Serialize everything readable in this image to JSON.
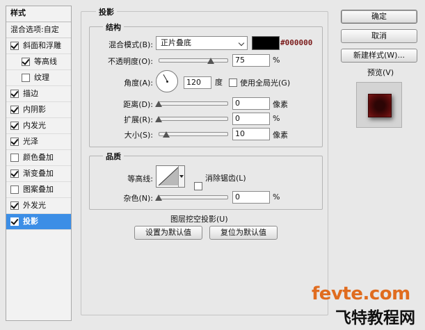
{
  "style_list": {
    "header": "样式",
    "blend_options": "混合选项:自定",
    "items": [
      {
        "label": "斜面和浮雕",
        "checked": true,
        "indent": false,
        "selected": false
      },
      {
        "label": "等高线",
        "checked": true,
        "indent": true,
        "selected": false
      },
      {
        "label": "纹理",
        "checked": false,
        "indent": true,
        "selected": false
      },
      {
        "label": "描边",
        "checked": true,
        "indent": false,
        "selected": false
      },
      {
        "label": "内阴影",
        "checked": true,
        "indent": false,
        "selected": false
      },
      {
        "label": "内发光",
        "checked": true,
        "indent": false,
        "selected": false
      },
      {
        "label": "光泽",
        "checked": true,
        "indent": false,
        "selected": false
      },
      {
        "label": "颜色叠加",
        "checked": false,
        "indent": false,
        "selected": false
      },
      {
        "label": "渐变叠加",
        "checked": true,
        "indent": false,
        "selected": false
      },
      {
        "label": "图案叠加",
        "checked": false,
        "indent": false,
        "selected": false
      },
      {
        "label": "外发光",
        "checked": true,
        "indent": false,
        "selected": false
      },
      {
        "label": "投影",
        "checked": true,
        "indent": false,
        "selected": true
      }
    ]
  },
  "panel": {
    "title": "投影",
    "structure": {
      "title": "结构",
      "blend_mode_label": "混合模式(B):",
      "blend_mode_value": "正片叠底",
      "color_hex": "#000000",
      "opacity_label": "不透明度(O):",
      "opacity_value": "75",
      "opacity_unit": "%",
      "angle_label": "角度(A):",
      "angle_value": "120",
      "angle_unit": "度",
      "global_light_label": "使用全局光(G)",
      "distance_label": "距离(D):",
      "distance_value": "0",
      "distance_unit": "像素",
      "spread_label": "扩展(R):",
      "spread_value": "0",
      "spread_unit": "%",
      "size_label": "大小(S):",
      "size_value": "10",
      "size_unit": "像素"
    },
    "quality": {
      "title": "品质",
      "contour_label": "等高线:",
      "antialias_label": "消除锯齿(L)",
      "noise_label": "杂色(N):",
      "noise_value": "0",
      "noise_unit": "%"
    },
    "knockout_label": "图层挖空投影(U)",
    "make_default": "设置为默认值",
    "reset_default": "复位为默认值"
  },
  "buttons": {
    "ok": "确定",
    "cancel": "取消",
    "new_style": "新建样式(W)...",
    "preview_label": "预览(V)"
  },
  "watermark": {
    "line1": "fevte.com",
    "line2": "飞特教程网"
  },
  "colors": {
    "selected_bg": "#3c8ee6",
    "shadow_color": "#000000",
    "hex_text": "#7a1a1a",
    "preview_swatch": "#5a0c0c"
  }
}
